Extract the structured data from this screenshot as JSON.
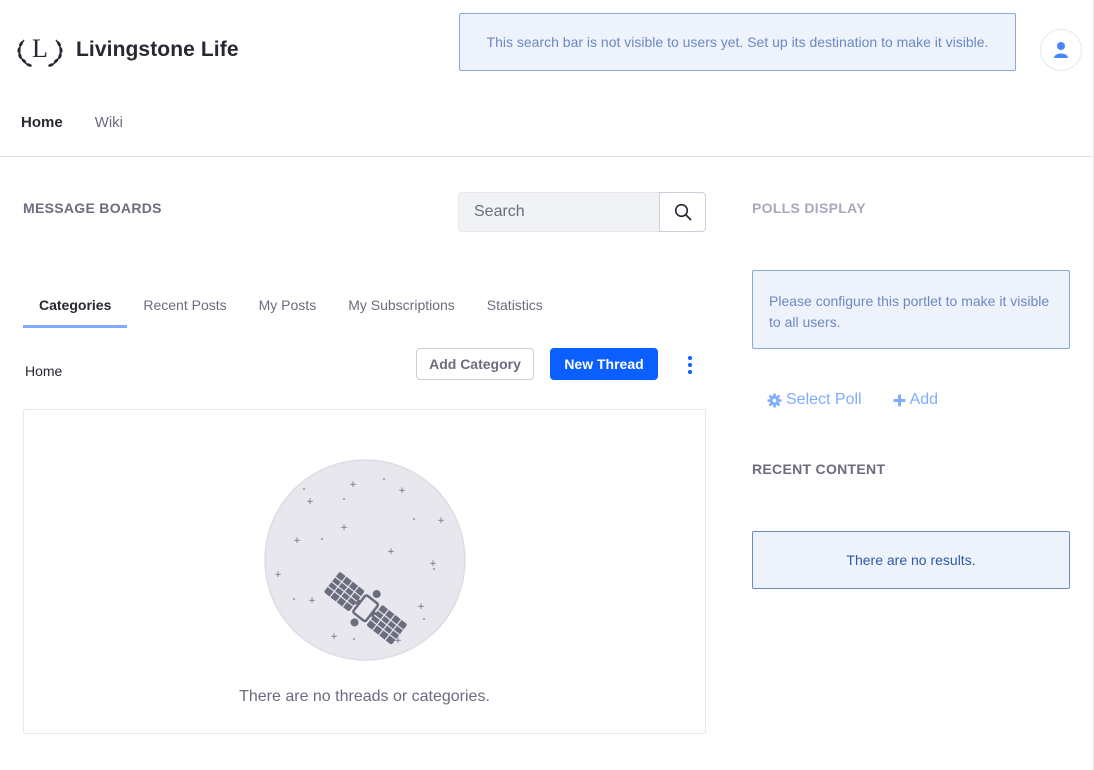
{
  "header": {
    "site_name": "Livingstone Life",
    "logo_letter": "L",
    "search_notice": "This search bar is not visible to users yet. Set up its destination to make it visible.",
    "user_icon": "user-icon"
  },
  "nav": {
    "items": [
      {
        "label": "Home",
        "active": true
      },
      {
        "label": "Wiki",
        "active": false
      }
    ]
  },
  "message_boards": {
    "title": "MESSAGE BOARDS",
    "search_placeholder": "Search",
    "search_icon": "search-icon",
    "tabs": [
      {
        "label": "Categories",
        "active": true
      },
      {
        "label": "Recent Posts",
        "active": false
      },
      {
        "label": "My Posts",
        "active": false
      },
      {
        "label": "My Subscriptions",
        "active": false
      },
      {
        "label": "Statistics",
        "active": false
      }
    ],
    "breadcrumb": "Home",
    "add_category_label": "Add Category",
    "new_thread_label": "New Thread",
    "options_icon": "ellipsis-vertical-icon",
    "empty_illustration": "satellite-illustration",
    "empty_message": "There are no threads or categories."
  },
  "polls": {
    "title": "POLLS DISPLAY",
    "notice": "Please configure this portlet to make it visible to all users.",
    "select_poll_label": "Select Poll",
    "select_poll_icon": "cog-icon",
    "add_label": "Add",
    "add_icon": "plus-icon"
  },
  "recent_content": {
    "title": "RECENT CONTENT",
    "no_results": "There are no results."
  },
  "colors": {
    "primary": "#0b5fff",
    "info_bg": "#eef2fa",
    "info_border": "#89a7e0",
    "info_text": "#6b89c4",
    "secondary_text": "#6b6c7e",
    "tab_underline": "#80acff"
  }
}
